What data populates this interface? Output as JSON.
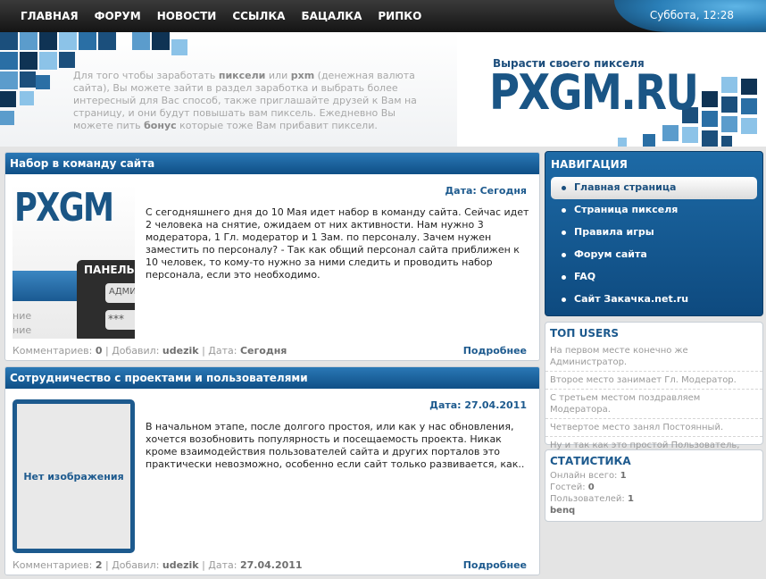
{
  "nav": {
    "items": [
      "ГЛАВНАЯ",
      "ФОРУМ",
      "НОВОСТИ",
      "ССЫЛКА",
      "БАЦАЛКА",
      "РИПКО"
    ],
    "clock": "Суббота, 12:28"
  },
  "header": {
    "intro_1": "Для того чтобы заработать ",
    "intro_b1": "пиксели",
    "intro_2": " или ",
    "intro_b2": "pxm",
    "intro_3": " (денежная валюта сайта), Вы можете зайти в раздел заработка и выбрать более интересный для Вас способ, также приглашайте друзей к Вам на страницу, и они будут повышать вам пиксель. Ежедневно Вы можете пить ",
    "intro_b3": "бонус",
    "intro_4": " которые тоже Вам прибавит пиксели.",
    "slogan": "Вырасти своего пикселя",
    "logo": "PXGM.RU"
  },
  "posts": [
    {
      "title": "Набор в команду сайта",
      "date_label": "Дата:",
      "date": "Сегодня",
      "thumb_logo": "PXGM",
      "thumb_panel": "ПАНЕЛЬ",
      "thumb_admin": "АДМИ",
      "thumb_stars": "***",
      "thumb_side": "ние",
      "text": "С сегодняшнего дня до 10 Мая идет набор в команду сайта. Сейчас идет 2 человека на снятие, ожидаем от них активности. Нам нужно 3 модератора, 1 Гл. модератор и 1 Зам. по персоналу. Зачем нужен заместить по персоналу? - Так как общий персонал сайта приближен к 10 человек, то кому-то нужно за ними следить и проводить набор персонала, если это необходимо.",
      "comments_label": "Комментариев:",
      "comments": "0",
      "added_label": "Добавил:",
      "author": "udezik",
      "foot_date_label": "Дата:",
      "foot_date": "Сегодня",
      "more": "Подробнее"
    },
    {
      "title": "Сотрудничество с проектами и пользователями",
      "date_label": "Дата:",
      "date": "27.04.2011",
      "noimg": "Нет изображения",
      "text": "В начальном этапе, после долгого простоя, или как у нас обновления, хочется возобновить популярность и посещаемость проекта. Никак кроме взаимодействия пользователей сайта и других порталов это практически невозможно, особенно если сайт только развивается, как..",
      "comments_label": "Комментариев:",
      "comments": "2",
      "added_label": "Добавил:",
      "author": "udezik",
      "foot_date_label": "Дата:",
      "foot_date": "27.04.2011",
      "more": "Подробнее"
    }
  ],
  "navigation": {
    "title": "НАВИГАЦИЯ",
    "items": [
      "Главная страница",
      "Страница пикселя",
      "Правила игры",
      "Форум сайта",
      "FAQ",
      "Сайт Закачка.net.ru"
    ]
  },
  "top_users": {
    "title": "ТОП USERS",
    "items": [
      "На первом месте конечно же Администратор.",
      "Второе место занимает Гл. Модератор.",
      "С третьем местом поздравляем Модератора.",
      "Четвертое место занял Постоянный.",
      "Ну и так как это простой Пользователь, даем ему самое последнее место!"
    ]
  },
  "stats": {
    "title": "СТАТИСТИКА",
    "online_label": "Онлайн всего:",
    "online": "1",
    "guests_label": "Гостей:",
    "guests": "0",
    "users_label": "Пользователей:",
    "users": "1",
    "user_name": "benq"
  },
  "colors": {
    "accent": "#1d5a8e",
    "bar": "#141414"
  }
}
